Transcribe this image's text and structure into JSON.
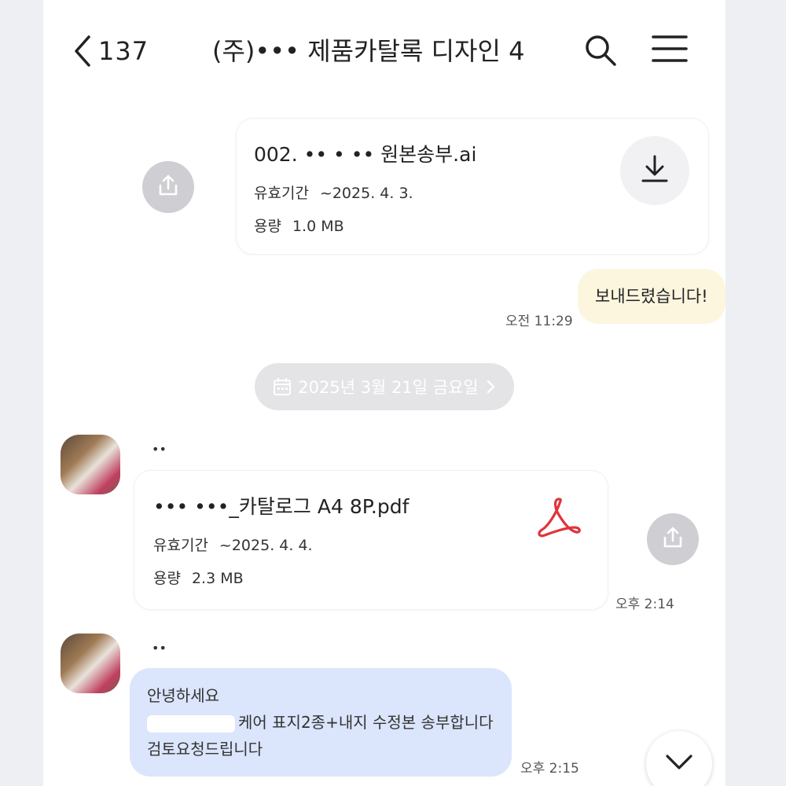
{
  "header": {
    "back_count": "137",
    "title": "(주)••• 제품카탈록 디자인 4"
  },
  "messages": [
    {
      "file_name": "002. •• • •• 원본송부.ai",
      "expiry_label": "유효기간",
      "expiry_value": "~2025. 4. 3.",
      "size_label": "용량",
      "size_value": "1.0 MB"
    },
    {
      "text": "보내드렸습니다!",
      "time": "오전 11:29"
    },
    {
      "date_label": "2025년 3월 21일 금요일"
    },
    {
      "sender": "••",
      "file_name": "••• •••_카탈로그 A4 8P.pdf",
      "expiry_label": "유효기간",
      "expiry_value": "~2025. 4. 4.",
      "size_label": "용량",
      "size_value": "2.3 MB",
      "time": "오후 2:14"
    },
    {
      "sender": "••",
      "line1": "안녕하세요",
      "line2": "케어 표지2종+내지 수정본 송부합니다",
      "line3": "검토요청드립니다",
      "time": "오후 2:15"
    }
  ],
  "colors": {
    "my_bubble": "#fcf6df",
    "other_bubble": "#dbe5fb",
    "pdf_icon": "#e0343a"
  }
}
